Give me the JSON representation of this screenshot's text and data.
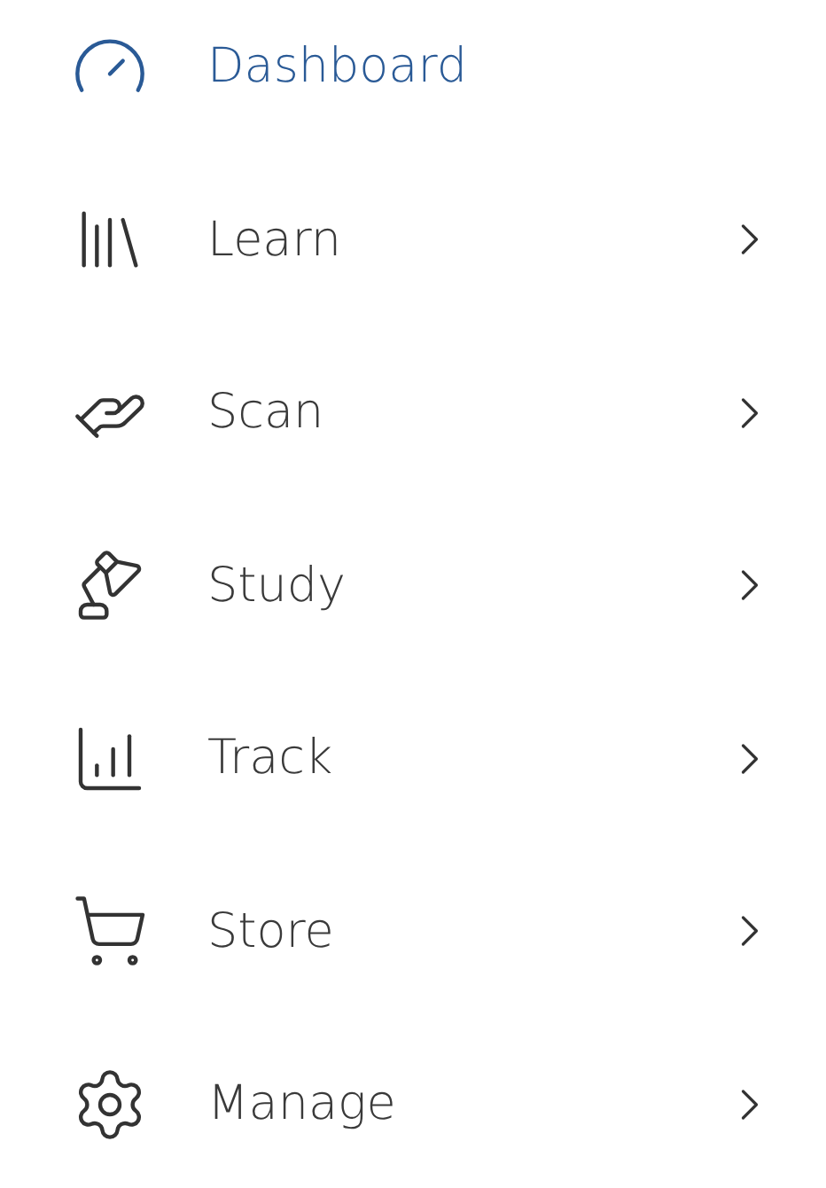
{
  "menu": {
    "items": [
      {
        "label": "Dashboard",
        "selected": true,
        "expandable": false
      },
      {
        "label": "Learn",
        "selected": false,
        "expandable": true
      },
      {
        "label": "Scan",
        "selected": false,
        "expandable": true
      },
      {
        "label": "Study",
        "selected": false,
        "expandable": true
      },
      {
        "label": "Track",
        "selected": false,
        "expandable": true
      },
      {
        "label": "Store",
        "selected": false,
        "expandable": true
      },
      {
        "label": "Manage",
        "selected": false,
        "expandable": true
      }
    ]
  }
}
